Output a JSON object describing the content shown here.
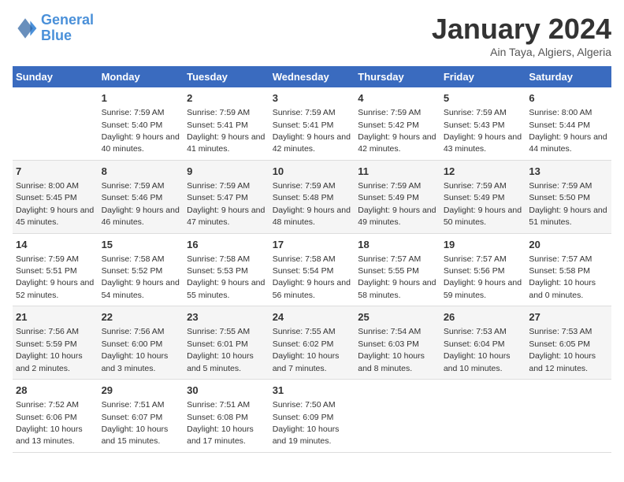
{
  "logo": {
    "line1": "General",
    "line2": "Blue"
  },
  "title": "January 2024",
  "subtitle": "Ain Taya, Algiers, Algeria",
  "days_header": [
    "Sunday",
    "Monday",
    "Tuesday",
    "Wednesday",
    "Thursday",
    "Friday",
    "Saturday"
  ],
  "weeks": [
    [
      {
        "num": "",
        "sunrise": "",
        "sunset": "",
        "daylight": ""
      },
      {
        "num": "1",
        "sunrise": "Sunrise: 7:59 AM",
        "sunset": "Sunset: 5:40 PM",
        "daylight": "Daylight: 9 hours and 40 minutes."
      },
      {
        "num": "2",
        "sunrise": "Sunrise: 7:59 AM",
        "sunset": "Sunset: 5:41 PM",
        "daylight": "Daylight: 9 hours and 41 minutes."
      },
      {
        "num": "3",
        "sunrise": "Sunrise: 7:59 AM",
        "sunset": "Sunset: 5:41 PM",
        "daylight": "Daylight: 9 hours and 42 minutes."
      },
      {
        "num": "4",
        "sunrise": "Sunrise: 7:59 AM",
        "sunset": "Sunset: 5:42 PM",
        "daylight": "Daylight: 9 hours and 42 minutes."
      },
      {
        "num": "5",
        "sunrise": "Sunrise: 7:59 AM",
        "sunset": "Sunset: 5:43 PM",
        "daylight": "Daylight: 9 hours and 43 minutes."
      },
      {
        "num": "6",
        "sunrise": "Sunrise: 8:00 AM",
        "sunset": "Sunset: 5:44 PM",
        "daylight": "Daylight: 9 hours and 44 minutes."
      }
    ],
    [
      {
        "num": "7",
        "sunrise": "Sunrise: 8:00 AM",
        "sunset": "Sunset: 5:45 PM",
        "daylight": "Daylight: 9 hours and 45 minutes."
      },
      {
        "num": "8",
        "sunrise": "Sunrise: 7:59 AM",
        "sunset": "Sunset: 5:46 PM",
        "daylight": "Daylight: 9 hours and 46 minutes."
      },
      {
        "num": "9",
        "sunrise": "Sunrise: 7:59 AM",
        "sunset": "Sunset: 5:47 PM",
        "daylight": "Daylight: 9 hours and 47 minutes."
      },
      {
        "num": "10",
        "sunrise": "Sunrise: 7:59 AM",
        "sunset": "Sunset: 5:48 PM",
        "daylight": "Daylight: 9 hours and 48 minutes."
      },
      {
        "num": "11",
        "sunrise": "Sunrise: 7:59 AM",
        "sunset": "Sunset: 5:49 PM",
        "daylight": "Daylight: 9 hours and 49 minutes."
      },
      {
        "num": "12",
        "sunrise": "Sunrise: 7:59 AM",
        "sunset": "Sunset: 5:49 PM",
        "daylight": "Daylight: 9 hours and 50 minutes."
      },
      {
        "num": "13",
        "sunrise": "Sunrise: 7:59 AM",
        "sunset": "Sunset: 5:50 PM",
        "daylight": "Daylight: 9 hours and 51 minutes."
      }
    ],
    [
      {
        "num": "14",
        "sunrise": "Sunrise: 7:59 AM",
        "sunset": "Sunset: 5:51 PM",
        "daylight": "Daylight: 9 hours and 52 minutes."
      },
      {
        "num": "15",
        "sunrise": "Sunrise: 7:58 AM",
        "sunset": "Sunset: 5:52 PM",
        "daylight": "Daylight: 9 hours and 54 minutes."
      },
      {
        "num": "16",
        "sunrise": "Sunrise: 7:58 AM",
        "sunset": "Sunset: 5:53 PM",
        "daylight": "Daylight: 9 hours and 55 minutes."
      },
      {
        "num": "17",
        "sunrise": "Sunrise: 7:58 AM",
        "sunset": "Sunset: 5:54 PM",
        "daylight": "Daylight: 9 hours and 56 minutes."
      },
      {
        "num": "18",
        "sunrise": "Sunrise: 7:57 AM",
        "sunset": "Sunset: 5:55 PM",
        "daylight": "Daylight: 9 hours and 58 minutes."
      },
      {
        "num": "19",
        "sunrise": "Sunrise: 7:57 AM",
        "sunset": "Sunset: 5:56 PM",
        "daylight": "Daylight: 9 hours and 59 minutes."
      },
      {
        "num": "20",
        "sunrise": "Sunrise: 7:57 AM",
        "sunset": "Sunset: 5:58 PM",
        "daylight": "Daylight: 10 hours and 0 minutes."
      }
    ],
    [
      {
        "num": "21",
        "sunrise": "Sunrise: 7:56 AM",
        "sunset": "Sunset: 5:59 PM",
        "daylight": "Daylight: 10 hours and 2 minutes."
      },
      {
        "num": "22",
        "sunrise": "Sunrise: 7:56 AM",
        "sunset": "Sunset: 6:00 PM",
        "daylight": "Daylight: 10 hours and 3 minutes."
      },
      {
        "num": "23",
        "sunrise": "Sunrise: 7:55 AM",
        "sunset": "Sunset: 6:01 PM",
        "daylight": "Daylight: 10 hours and 5 minutes."
      },
      {
        "num": "24",
        "sunrise": "Sunrise: 7:55 AM",
        "sunset": "Sunset: 6:02 PM",
        "daylight": "Daylight: 10 hours and 7 minutes."
      },
      {
        "num": "25",
        "sunrise": "Sunrise: 7:54 AM",
        "sunset": "Sunset: 6:03 PM",
        "daylight": "Daylight: 10 hours and 8 minutes."
      },
      {
        "num": "26",
        "sunrise": "Sunrise: 7:53 AM",
        "sunset": "Sunset: 6:04 PM",
        "daylight": "Daylight: 10 hours and 10 minutes."
      },
      {
        "num": "27",
        "sunrise": "Sunrise: 7:53 AM",
        "sunset": "Sunset: 6:05 PM",
        "daylight": "Daylight: 10 hours and 12 minutes."
      }
    ],
    [
      {
        "num": "28",
        "sunrise": "Sunrise: 7:52 AM",
        "sunset": "Sunset: 6:06 PM",
        "daylight": "Daylight: 10 hours and 13 minutes."
      },
      {
        "num": "29",
        "sunrise": "Sunrise: 7:51 AM",
        "sunset": "Sunset: 6:07 PM",
        "daylight": "Daylight: 10 hours and 15 minutes."
      },
      {
        "num": "30",
        "sunrise": "Sunrise: 7:51 AM",
        "sunset": "Sunset: 6:08 PM",
        "daylight": "Daylight: 10 hours and 17 minutes."
      },
      {
        "num": "31",
        "sunrise": "Sunrise: 7:50 AM",
        "sunset": "Sunset: 6:09 PM",
        "daylight": "Daylight: 10 hours and 19 minutes."
      },
      {
        "num": "",
        "sunrise": "",
        "sunset": "",
        "daylight": ""
      },
      {
        "num": "",
        "sunrise": "",
        "sunset": "",
        "daylight": ""
      },
      {
        "num": "",
        "sunrise": "",
        "sunset": "",
        "daylight": ""
      }
    ]
  ]
}
